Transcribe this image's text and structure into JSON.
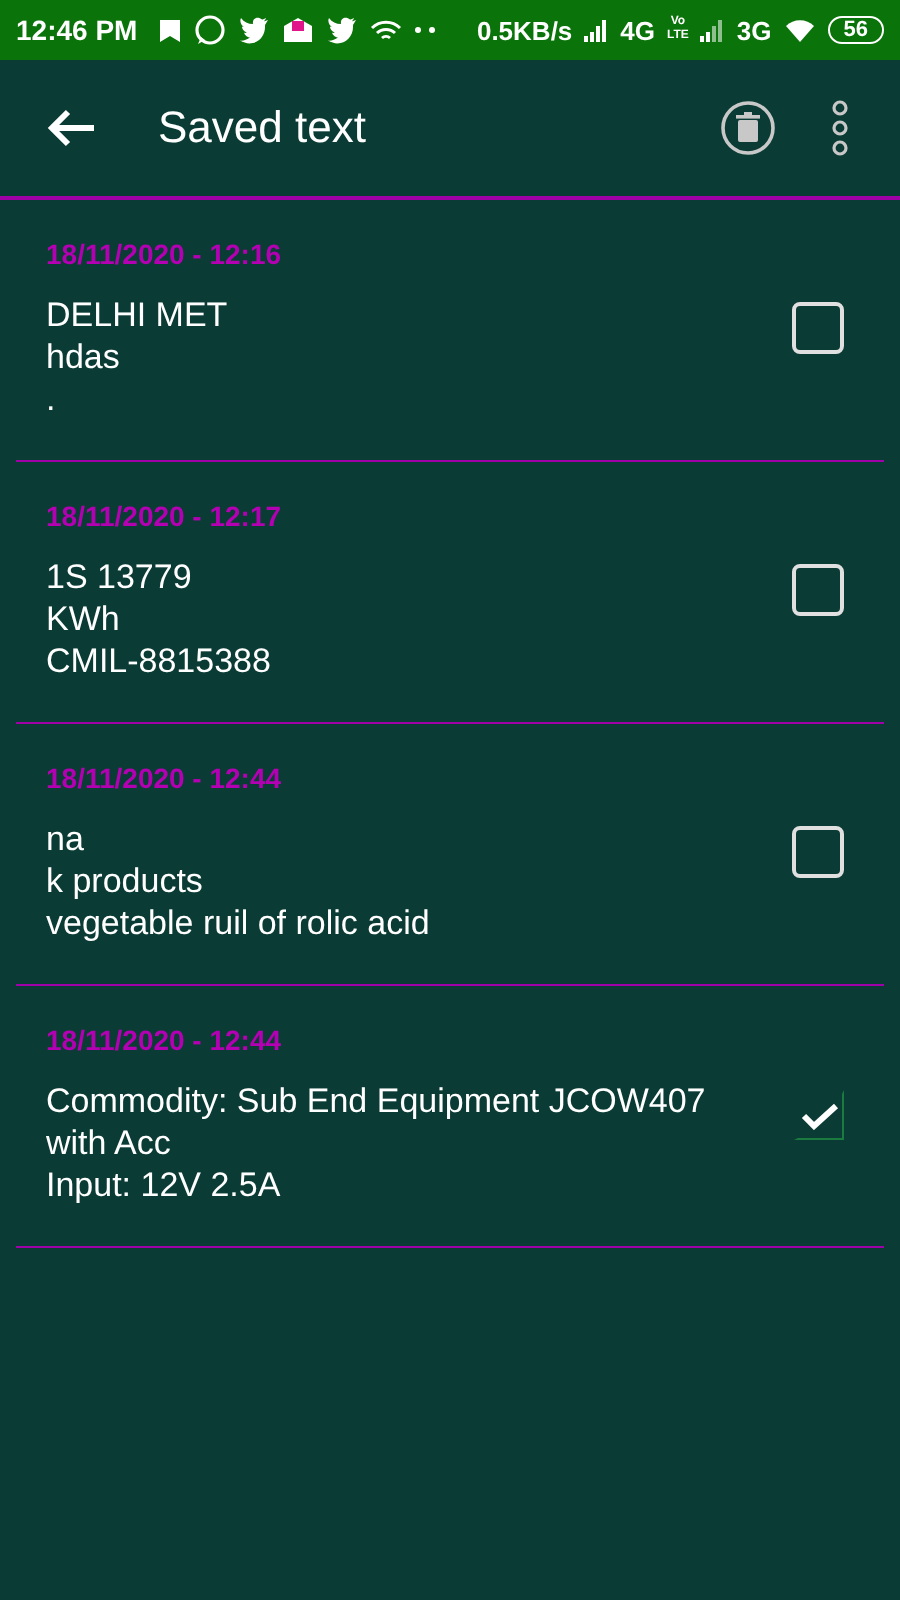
{
  "status_bar": {
    "time": "12:46 PM",
    "speed": "0.5KB/s",
    "network_1": "4G",
    "volte_top": "Vo",
    "volte_bottom": "LTE",
    "network_2": "3G",
    "battery": "56"
  },
  "app_bar": {
    "title": "Saved text"
  },
  "entries": [
    {
      "date": "18/11/2020 - 12:16",
      "text": "DELHI MET\nhdas\n.",
      "checked": false
    },
    {
      "date": "18/11/2020 - 12:17",
      "text": "1S 13779\nKWh\nCMIL-8815388",
      "checked": false
    },
    {
      "date": "18/11/2020 - 12:44",
      "text": "na\nk products\nvegetable ruil of rolic acid",
      "checked": false
    },
    {
      "date": "18/11/2020 - 12:44",
      "text": "Commodity: Sub End Equipment JCOW407\nwith Acc\nInput: 12V 2.5A",
      "checked": true
    }
  ]
}
